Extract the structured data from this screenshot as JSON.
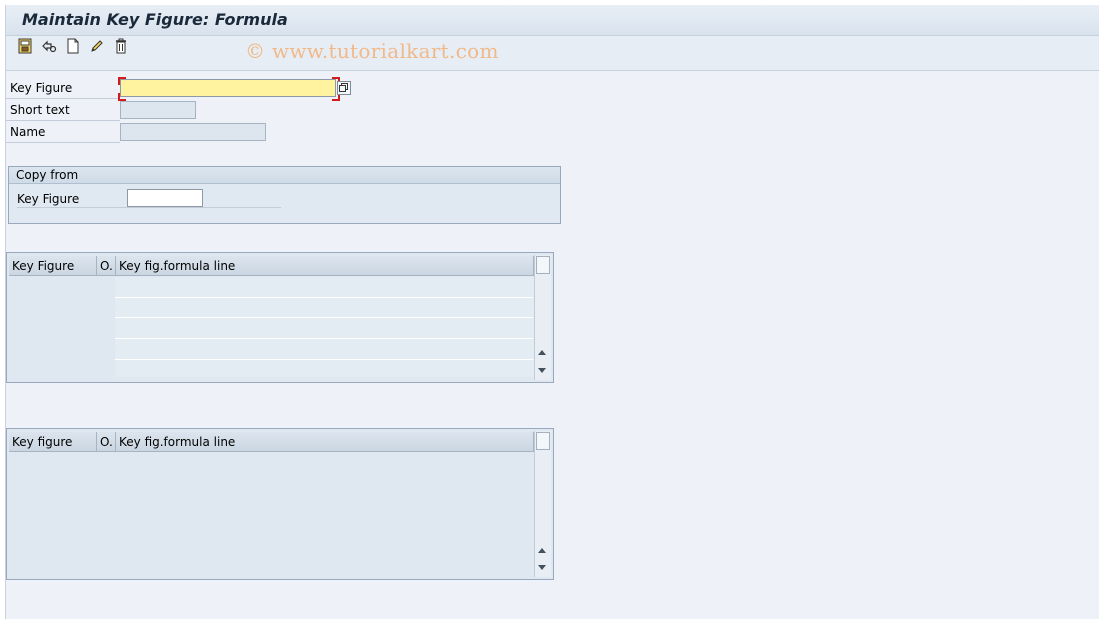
{
  "window": {
    "title": "Maintain Key Figure: Formula"
  },
  "toolbar": {
    "icons": [
      "display-change-icon",
      "other-object-icon",
      "create-icon",
      "change-icon",
      "delete-icon"
    ],
    "watermark": "© www.tutorialkart.com"
  },
  "form": {
    "key_figure_label": "Key Figure",
    "key_figure_value": "",
    "short_text_label": "Short text",
    "short_text_value": "",
    "name_label": "Name",
    "name_value": ""
  },
  "copy_from": {
    "title": "Copy from",
    "key_figure_label": "Key Figure",
    "key_figure_value": ""
  },
  "table1": {
    "columns": [
      "Key Figure",
      "O.",
      "Key fig.formula line"
    ],
    "rows": []
  },
  "table2": {
    "columns": [
      "Key figure",
      "O.",
      "Key fig.formula line"
    ],
    "rows": []
  },
  "colors": {
    "required_marker": "#d21c1c",
    "active_field": "#fff39f",
    "watermark": "#f0b98a"
  }
}
